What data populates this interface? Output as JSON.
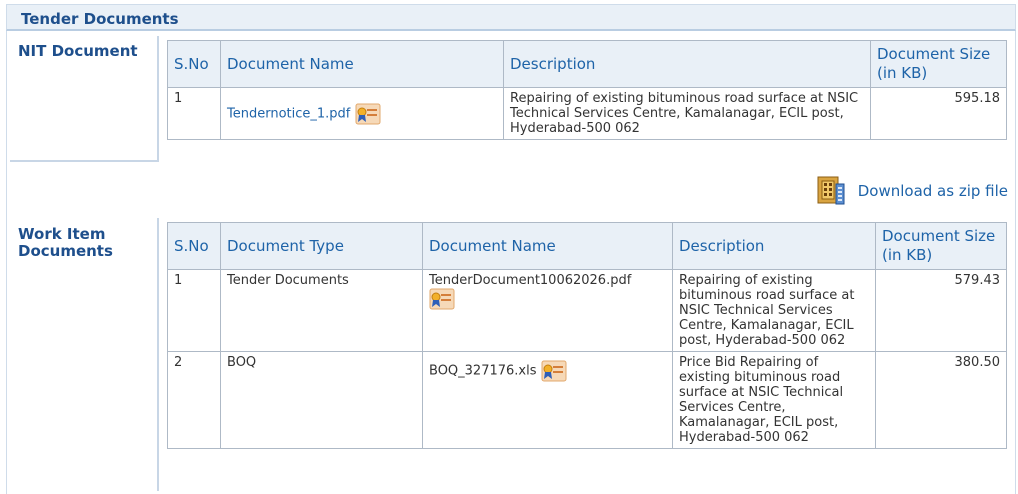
{
  "panel": {
    "title": "Tender Documents"
  },
  "nit": {
    "label": "NIT Document",
    "headers": [
      "S.No",
      "Document Name",
      "Description",
      "Document Size (in KB)"
    ],
    "rows": [
      {
        "sno": "1",
        "name": "Tendernotice_1.pdf",
        "description": "Repairing of existing bituminous road surface at NSIC Technical Services Centre, Kamalanagar, ECIL post, Hyderabad-500 062",
        "size": "595.18"
      }
    ]
  },
  "zip": {
    "label": "Download as zip file",
    "icon": "zip-archive-icon"
  },
  "work": {
    "label": "Work Item Documents",
    "headers": [
      "S.No",
      "Document Type",
      "Document Name",
      "Description",
      "Document Size (in KB)"
    ],
    "rows": [
      {
        "sno": "1",
        "type": "Tender Documents",
        "name": "TenderDocument10062026.pdf",
        "description": "Repairing of existing bituminous road surface at NSIC Technical Services Centre, Kamalanagar, ECIL post, Hyderabad-500 062",
        "size": "579.43"
      },
      {
        "sno": "2",
        "type": "BOQ",
        "name": "BOQ_327176.xls",
        "description": "Price Bid Repairing of existing bituminous road surface at NSIC Technical Services Centre, Kamalanagar, ECIL post, Hyderabad-500 062",
        "size": "380.50"
      }
    ]
  }
}
